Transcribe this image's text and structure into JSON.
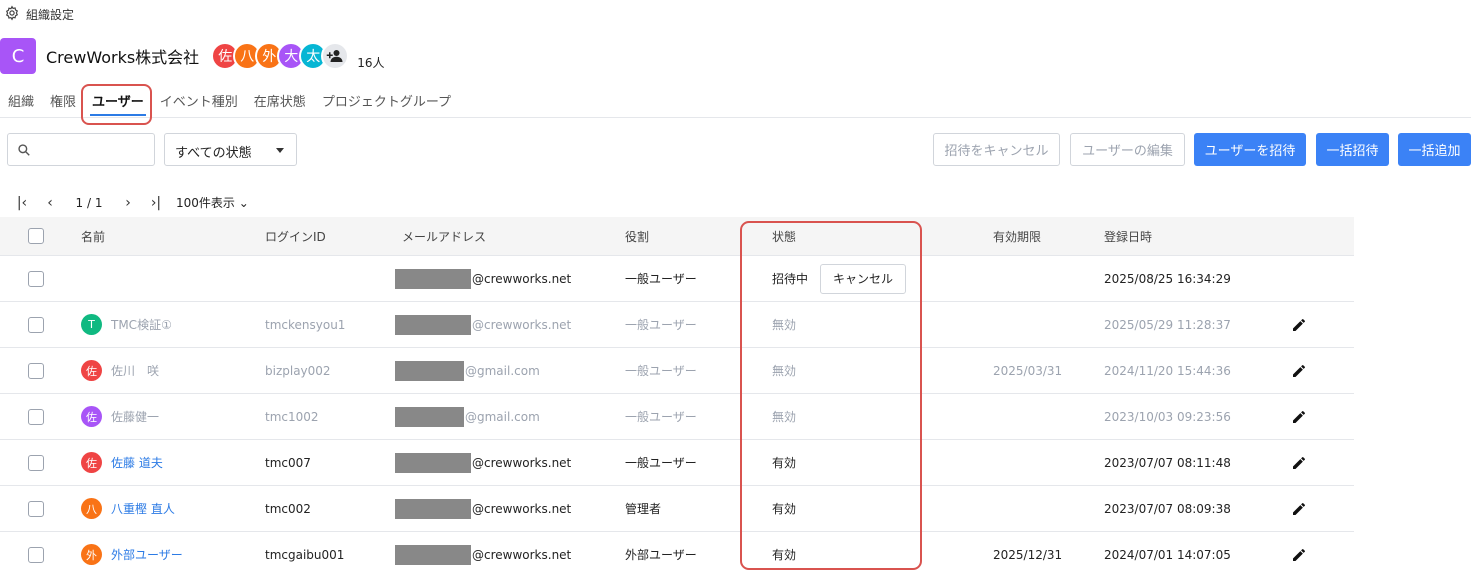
{
  "breadcrumb": {
    "label": "組織設定"
  },
  "org": {
    "logo_letter": "C",
    "name": "CrewWorks株式会社",
    "member_count": "16人",
    "avatars": [
      {
        "label": "佐",
        "color": "#ef4444"
      },
      {
        "label": "八",
        "color": "#f97316"
      },
      {
        "label": "外",
        "color": "#f97316"
      },
      {
        "label": "大",
        "color": "#a855f7"
      },
      {
        "label": "太",
        "color": "#06b6d4"
      }
    ]
  },
  "tabs": [
    {
      "label": "組織"
    },
    {
      "label": "権限"
    },
    {
      "label": "ユーザー",
      "active": true
    },
    {
      "label": "イベント種別"
    },
    {
      "label": "在席状態"
    },
    {
      "label": "プロジェクトグループ"
    }
  ],
  "toolbar": {
    "search_placeholder": "",
    "status_filter": "すべての状態",
    "cancel_invite_label": "招待をキャンセル",
    "edit_user_label": "ユーザーの編集",
    "invite_user_label": "ユーザーを招待",
    "bulk_invite_label": "一括招待",
    "bulk_add_label": "一括追加"
  },
  "pager": {
    "page": "1 / 1",
    "per_page": "100件表示"
  },
  "table": {
    "headers": {
      "name": "名前",
      "login_id": "ログインID",
      "email": "メールアドレス",
      "role": "役割",
      "status": "状態",
      "expiry": "有効期限",
      "registered": "登録日時"
    },
    "rows": [
      {
        "avatar": "",
        "avatar_color": "",
        "name": "",
        "login_id": "",
        "email_domain": "@crewworks.net",
        "role": "一般ユーザー",
        "status": "招待中",
        "cancel_label": "キャンセル",
        "expiry": "",
        "registered": "2025/08/25 16:34:29",
        "style": "normal",
        "editable": false
      },
      {
        "avatar": "T",
        "avatar_color": "#10b981",
        "name": "TMC検証①",
        "login_id": "tmckensyou1",
        "email_domain": "@crewworks.net",
        "role": "一般ユーザー",
        "status": "無効",
        "cancel_label": "",
        "expiry": "",
        "registered": "2025/05/29 11:28:37",
        "style": "muted",
        "editable": true
      },
      {
        "avatar": "佐",
        "avatar_color": "#ef4444",
        "name": "佐川　咲",
        "login_id": "bizplay002",
        "email_domain": "@gmail.com",
        "role": "一般ユーザー",
        "status": "無効",
        "cancel_label": "",
        "expiry": "2025/03/31",
        "registered": "2024/11/20 15:44:36",
        "style": "muted",
        "editable": true
      },
      {
        "avatar": "佐",
        "avatar_color": "#a855f7",
        "name": "佐藤健一",
        "login_id": "tmc1002",
        "email_domain": "@gmail.com",
        "role": "一般ユーザー",
        "status": "無効",
        "cancel_label": "",
        "expiry": "",
        "registered": "2023/10/03 09:23:56",
        "style": "muted",
        "editable": true
      },
      {
        "avatar": "佐",
        "avatar_color": "#ef4444",
        "name": "佐藤 道夫",
        "login_id": "tmc007",
        "email_domain": "@crewworks.net",
        "role": "一般ユーザー",
        "status": "有効",
        "cancel_label": "",
        "expiry": "",
        "registered": "2023/07/07 08:11:48",
        "style": "active",
        "editable": true
      },
      {
        "avatar": "八",
        "avatar_color": "#f97316",
        "name": "八重樫 直人",
        "login_id": "tmc002",
        "email_domain": "@crewworks.net",
        "role": "管理者",
        "status": "有効",
        "cancel_label": "",
        "expiry": "",
        "registered": "2023/07/07 08:09:38",
        "style": "active",
        "editable": true
      },
      {
        "avatar": "外",
        "avatar_color": "#f97316",
        "name": "外部ユーザー",
        "login_id": "tmcgaibu001",
        "email_domain": "@crewworks.net",
        "role": "外部ユーザー",
        "status": "有効",
        "cancel_label": "",
        "expiry": "2025/12/31",
        "registered": "2024/07/01 14:07:05",
        "style": "active",
        "editable": true
      }
    ]
  }
}
